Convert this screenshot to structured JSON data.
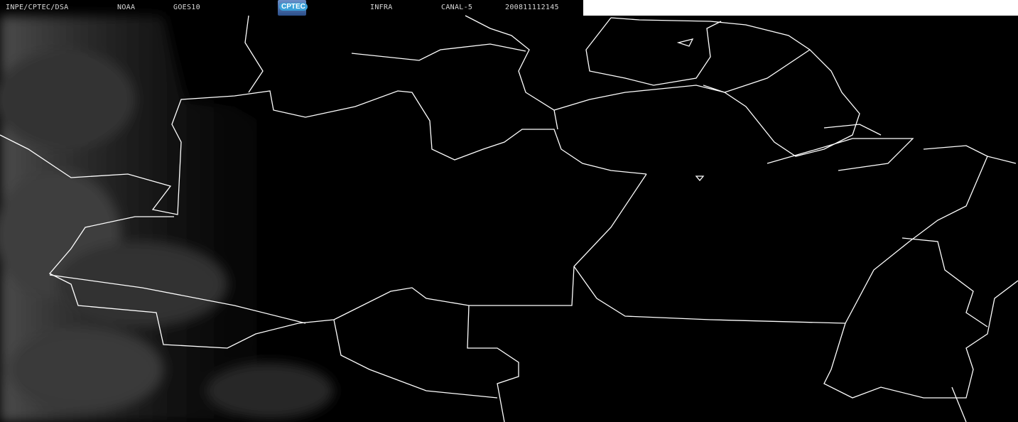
{
  "header": {
    "source": "INPE/CPTEC/DSA",
    "agency": "NOAA",
    "satellite": "GOES10",
    "logo_text": "CPTEC",
    "band": "INFRA",
    "channel": "CANAL-5",
    "timestamp": "200811112145"
  },
  "colors": {
    "background": "#000000",
    "borders": "#ffffff",
    "clouds": "#6a6a6a"
  }
}
